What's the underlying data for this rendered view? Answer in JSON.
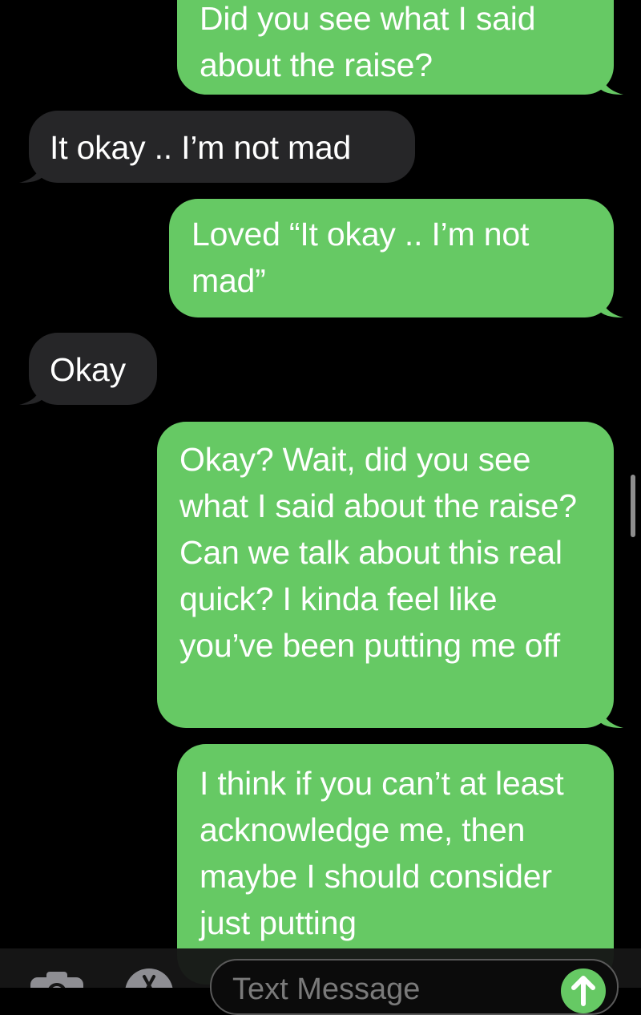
{
  "messages": [
    {
      "direction": "sent",
      "text": "Did you see what I said about the raise?"
    },
    {
      "direction": "received",
      "text": "It okay .. I’m not mad"
    },
    {
      "direction": "sent",
      "text": "Loved “It okay .. I’m not mad”"
    },
    {
      "direction": "received",
      "text": "Okay"
    },
    {
      "direction": "sent",
      "text": "Okay? Wait, did you see what I said about the raise? Can we talk about this real quick? I kinda feel like you’ve been putting me off"
    },
    {
      "direction": "sent",
      "text": "I think if you can’t at least acknowledge me, then maybe I should consider just putting"
    }
  ],
  "input": {
    "placeholder": "Text Message"
  },
  "icons": {
    "camera": "camera-icon",
    "apps": "app-store-icon",
    "send": "send-arrow-icon"
  },
  "colors": {
    "sent_bubble": "#66c964",
    "received_bubble": "#262628",
    "background": "#000000"
  }
}
